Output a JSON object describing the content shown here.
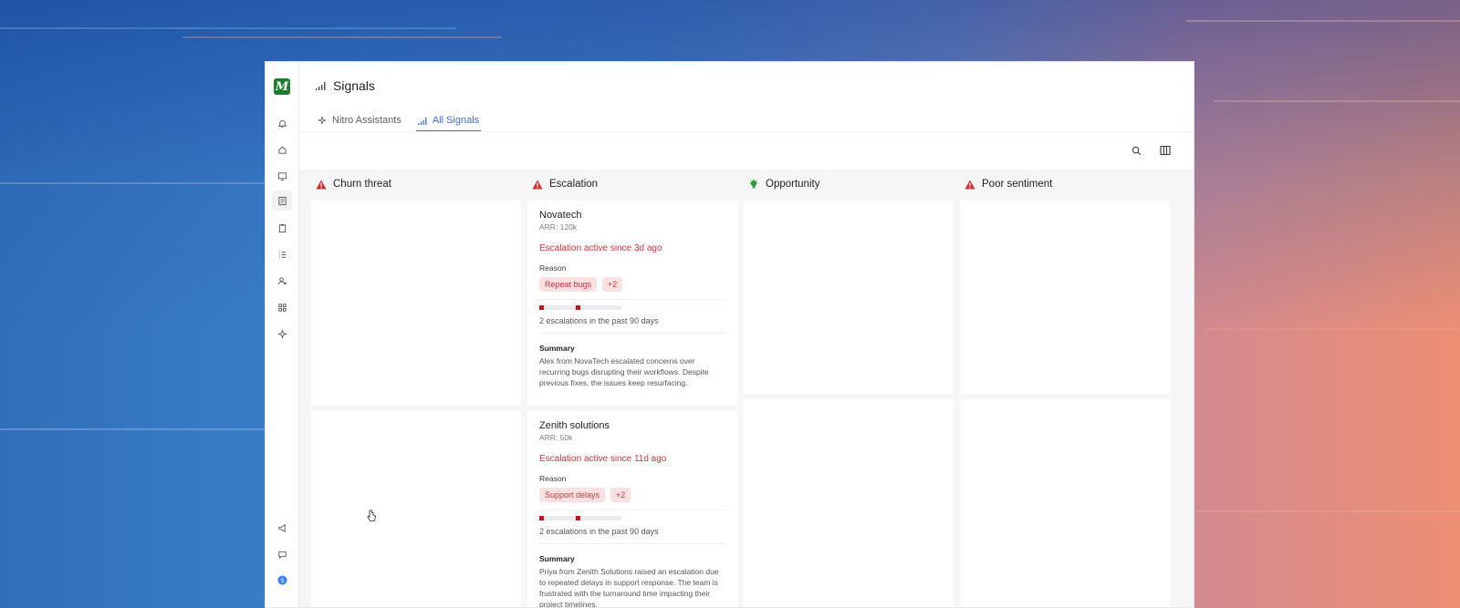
{
  "app": {
    "logo_text": "M",
    "page_title": "Signals",
    "accent_color": "#3f6bd8",
    "brand_color": "#1d7d2f"
  },
  "rail": {
    "top_icons": [
      "bell-icon",
      "home-icon",
      "monitor-icon",
      "book-icon",
      "clipboard-icon",
      "list-icon",
      "user-settings-icon",
      "grid-icon",
      "sparkle-icon"
    ],
    "bottom_icons": [
      "megaphone-icon",
      "chat-icon",
      "profile-avatar-icon"
    ]
  },
  "tabs": [
    {
      "label": "Nitro Assistants",
      "icon": "sparkle-icon",
      "active": false
    },
    {
      "label": "All Signals",
      "icon": "signal-bars-icon",
      "active": true
    }
  ],
  "toolbar": {
    "icons": [
      "search-icon",
      "columns-icon"
    ]
  },
  "columns": [
    {
      "name": "Churn threat",
      "icon": "warning-triangle-icon",
      "icon_color": "#d22b2b"
    },
    {
      "name": "Escalation",
      "icon": "warning-triangle-icon",
      "icon_color": "#d22b2b"
    },
    {
      "name": "Opportunity",
      "icon": "lightbulb-icon",
      "icon_color": "#2e9b3e"
    },
    {
      "name": "Poor sentiment",
      "icon": "warning-triangle-icon",
      "icon_color": "#d22b2b"
    }
  ],
  "escalation_cards": [
    {
      "company": "Novatech",
      "arr": "ARR: 120k",
      "status": "Escalation active since 3d ago",
      "reason_label": "Reason",
      "reason_chip": "Repeat bugs",
      "more_chip": "+2",
      "escalation_marks": [
        1,
        0,
        0,
        0,
        0,
        0,
        0,
        0,
        1,
        0,
        0,
        0,
        0,
        0,
        0,
        0,
        0,
        0
      ],
      "escalation_count": "2 escalations in the past 90 days",
      "summary_label": "Summary",
      "summary": "Alex from NovaTech escalated concerns over recurring bugs disrupting their workflows. Despite previous fixes, the issues keep resurfacing."
    },
    {
      "company": "Zenith solutions",
      "arr": "ARR: 50k",
      "status": "Escalation active since 11d ago",
      "reason_label": "Reason",
      "reason_chip": "Support delays",
      "more_chip": "+2",
      "escalation_marks": [
        1,
        0,
        0,
        0,
        0,
        0,
        0,
        0,
        1,
        0,
        0,
        0,
        0,
        0,
        0,
        0,
        0,
        0
      ],
      "escalation_count": "2 escalations in the past 90 days",
      "summary_label": "Summary",
      "summary": "Priya from Zenith Solutions raised an escalation due to repeated delays in support response. The team is frustrated with the turnaround time impacting their project timelines."
    }
  ]
}
